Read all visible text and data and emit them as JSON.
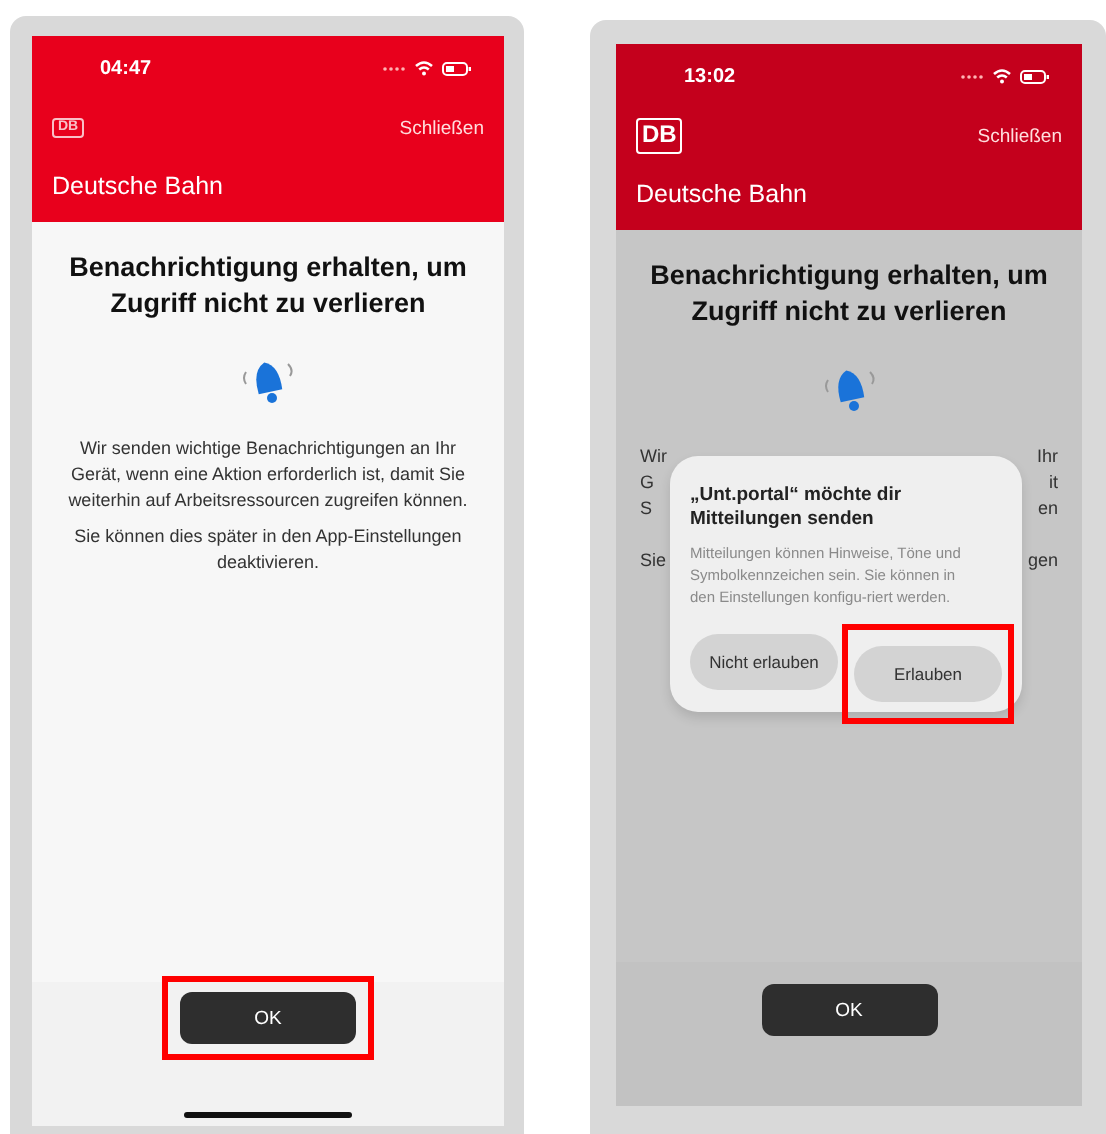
{
  "screens": [
    {
      "kind": "intro",
      "dimmed": false,
      "status_time": "04:47",
      "logo": "DB",
      "close_label": "Schließen",
      "app_title": "Deutsche Bahn",
      "heading": "Benachrichtigung erhalten, um Zugriff nicht zu verlieren",
      "paragraphs": [
        "Wir senden wichtige Benachrichtigungen an Ihr Gerät, wenn eine Aktion erforderlich ist, damit Sie weiterhin auf Arbeitsressourcen zugreifen können.",
        "Sie können dies später in den App-Einstellungen deaktivieren."
      ],
      "ok_button": {
        "label": "OK",
        "highlighted": true
      },
      "home_indicator": true
    },
    {
      "kind": "permission",
      "dimmed": true,
      "status_time": "13:02",
      "logo": "DB",
      "close_label": "Schließen",
      "app_title": "Deutsche Bahn",
      "heading": "Benachrichtigung erhalten, um Zugriff nicht zu verlieren",
      "fragments": [
        {
          "left": "Wir",
          "right": "Ihr"
        },
        {
          "left": "G",
          "right": "it"
        },
        {
          "left": "S",
          "right": "en"
        },
        {
          "left": "Sie",
          "right": "gen"
        }
      ],
      "dialog": {
        "title": "„Unt.portal“ möchte dir Mitteilungen senden",
        "message": "Mitteilungen können Hinweise, Töne und Symbolkennzeichen sein. Sie können in den Einstellungen konfigu-riert werden.",
        "buttons": [
          {
            "label": "Nicht erlauben",
            "highlighted": false
          },
          {
            "label": "Erlauben",
            "highlighted": true
          }
        ]
      },
      "ok_button": {
        "label": "OK",
        "highlighted": false
      },
      "home_indicator": false
    }
  ]
}
